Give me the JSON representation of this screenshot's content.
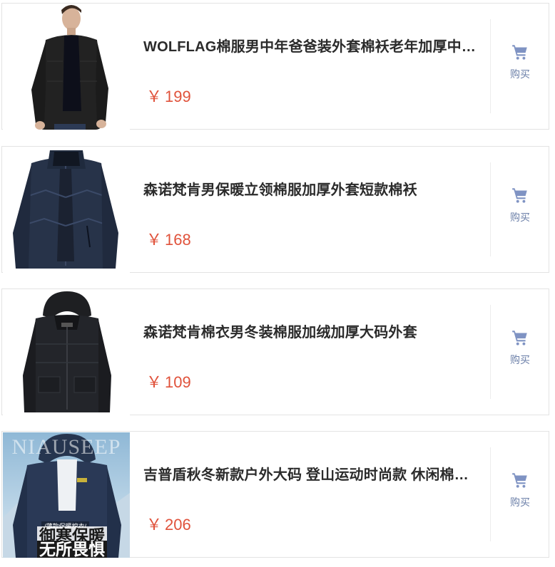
{
  "products": [
    {
      "title": "WOLFLAG棉服男中年爸爸装外套棉袄老年加厚中长款",
      "currency": "￥",
      "price": "199",
      "buy_label": "购买",
      "image_desc": "black-padded-coat-model"
    },
    {
      "title": "森诺梵肯男保暖立领棉服加厚外套短款棉袄",
      "currency": "￥",
      "price": "168",
      "buy_label": "购买",
      "image_desc": "navy-stand-collar-jacket"
    },
    {
      "title": "森诺梵肯棉衣男冬装棉服加绒加厚大码外套",
      "currency": "￥",
      "price": "109",
      "buy_label": "购买",
      "image_desc": "black-hooded-padded-jacket"
    },
    {
      "title": "吉普盾秋冬新款户外大码 登山运动时尚款 休闲棉衣加厚",
      "currency": "￥",
      "price": "206",
      "buy_label": "购买",
      "image_desc": "navy-outdoor-hooded-jacket",
      "ad": {
        "brand": "NIAUSEEP",
        "small": "/薄款保暖棉衣/",
        "line1": "御寒保暖",
        "line2": "无所畏惧"
      }
    }
  ],
  "colors": {
    "price": "#e0523b",
    "buy": "#6b7fa8",
    "cart_icon": "#7f93c3"
  },
  "icons": {
    "cart": "shopping-cart-icon"
  }
}
